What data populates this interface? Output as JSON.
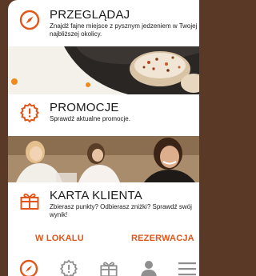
{
  "accent_color": "#e0561b",
  "sections": [
    {
      "icon": "compass-icon",
      "title": "PRZEGLĄDAJ",
      "description": "Znajdź fajne miejsce z pysznym jedzeniem w Twojej najbliższej okolicy."
    },
    {
      "icon": "promo-badge-icon",
      "title": "PROMOCJE",
      "description": "Sprawdź aktualne promocje."
    },
    {
      "icon": "gift-icon",
      "title": "KARTA KLIENTA",
      "description": "Zbierasz punkty? Odbierasz zniżki? Sprawdź swój wynik!"
    }
  ],
  "actions": {
    "left_label": "W LOKALU",
    "right_label": "REZERWACJA"
  },
  "bottom_nav": [
    "compass-icon",
    "promo-badge-icon",
    "gift-icon",
    "user-icon",
    "menu-icon"
  ]
}
